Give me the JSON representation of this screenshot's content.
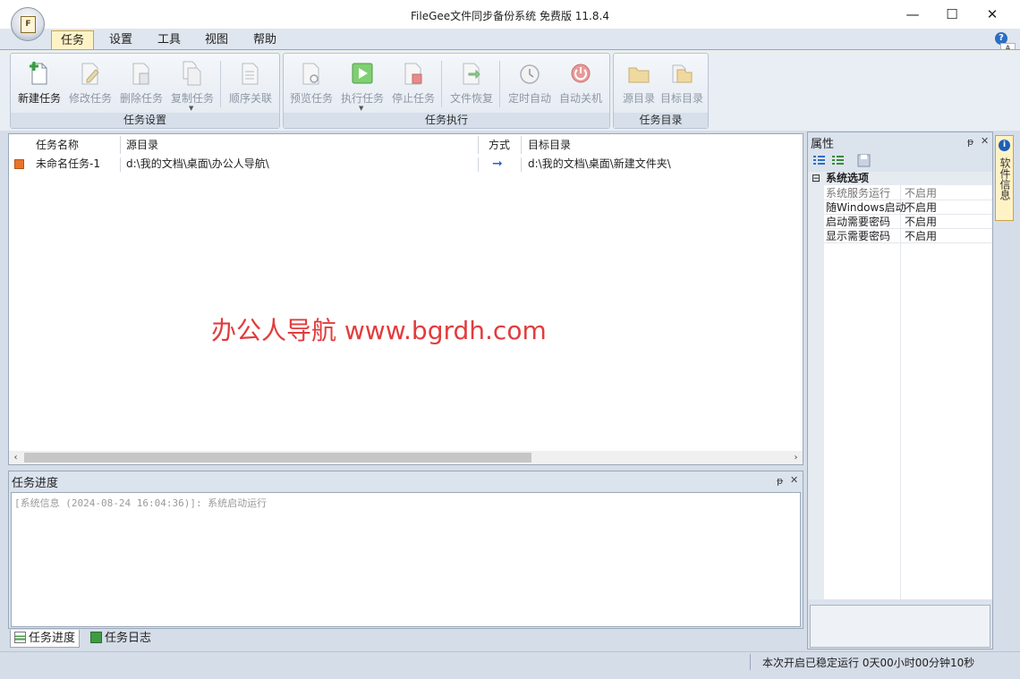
{
  "window": {
    "title": "FileGee文件同步备份系统 免费版 11.8.4",
    "app_button_letter": "F",
    "minimize": "—",
    "maximize": "☐",
    "close": "✕"
  },
  "menu": {
    "tabs": [
      "任务",
      "设置",
      "工具",
      "视图",
      "帮助"
    ],
    "active": "任务",
    "help_glyph": "?",
    "help_shortcut": "A"
  },
  "ribbon": {
    "groups": [
      {
        "label": "任务设置",
        "buttons": [
          {
            "label": "新建任务",
            "icon": "new-task-icon",
            "enabled": true
          },
          {
            "label": "修改任务",
            "icon": "edit-task-icon",
            "enabled": false
          },
          {
            "label": "删除任务",
            "icon": "delete-task-icon",
            "enabled": false
          },
          {
            "label": "复制任务",
            "icon": "copy-task-icon",
            "enabled": false
          },
          {
            "label": "顺序关联",
            "icon": "sequence-link-icon",
            "enabled": false
          }
        ]
      },
      {
        "label": "任务执行",
        "buttons": [
          {
            "label": "预览任务",
            "icon": "preview-task-icon",
            "enabled": false
          },
          {
            "label": "执行任务",
            "icon": "run-task-icon",
            "enabled": false
          },
          {
            "label": "停止任务",
            "icon": "stop-task-icon",
            "enabled": false
          },
          {
            "label": "文件恢复",
            "icon": "file-restore-icon",
            "enabled": false
          },
          {
            "label": "定时自动",
            "icon": "timer-auto-icon",
            "enabled": false
          },
          {
            "label": "自动关机",
            "icon": "auto-shutdown-icon",
            "enabled": false
          }
        ]
      },
      {
        "label": "任务目录",
        "buttons": [
          {
            "label": "源目录",
            "icon": "source-folder-icon",
            "enabled": false
          },
          {
            "label": "目标目录",
            "icon": "target-folder-icon",
            "enabled": false
          }
        ]
      }
    ]
  },
  "task_list": {
    "columns": [
      "任务名称",
      "源目录",
      "方式",
      "目标目录"
    ],
    "rows": [
      {
        "name": "未命名任务-1",
        "source": "d:\\我的文档\\桌面\\办公人导航\\",
        "mode": "➞",
        "target": "d:\\我的文档\\桌面\\新建文件夹\\"
      }
    ],
    "scroll_left": "‹",
    "scroll_right": "›"
  },
  "watermark": "办公人导航 www.bgrdh.com",
  "progress": {
    "title": "任务进度",
    "lines": [
      "[系统信息 (2024-08-24 16:04:36)]: 系统启动运行"
    ],
    "pin": "ᵽ",
    "close": "✕"
  },
  "bottom_tabs": [
    "任务进度",
    "任务日志"
  ],
  "properties": {
    "title": "属性",
    "category": "系统选项",
    "collapse_glyph": "⊟",
    "items": [
      {
        "key": "系统服务运行",
        "value": "不启用"
      },
      {
        "key": "随Windows启动",
        "value": "不启用"
      },
      {
        "key": "启动需要密码",
        "value": "不启用"
      },
      {
        "key": "显示需要密码",
        "value": "不启用"
      }
    ],
    "pin": "ᵽ",
    "close": "✕"
  },
  "side_tab": {
    "label": "软件信息",
    "glyph": "i"
  },
  "status": {
    "uptime": "本次开启已稳定运行 0天00小时00分钟10秒"
  }
}
